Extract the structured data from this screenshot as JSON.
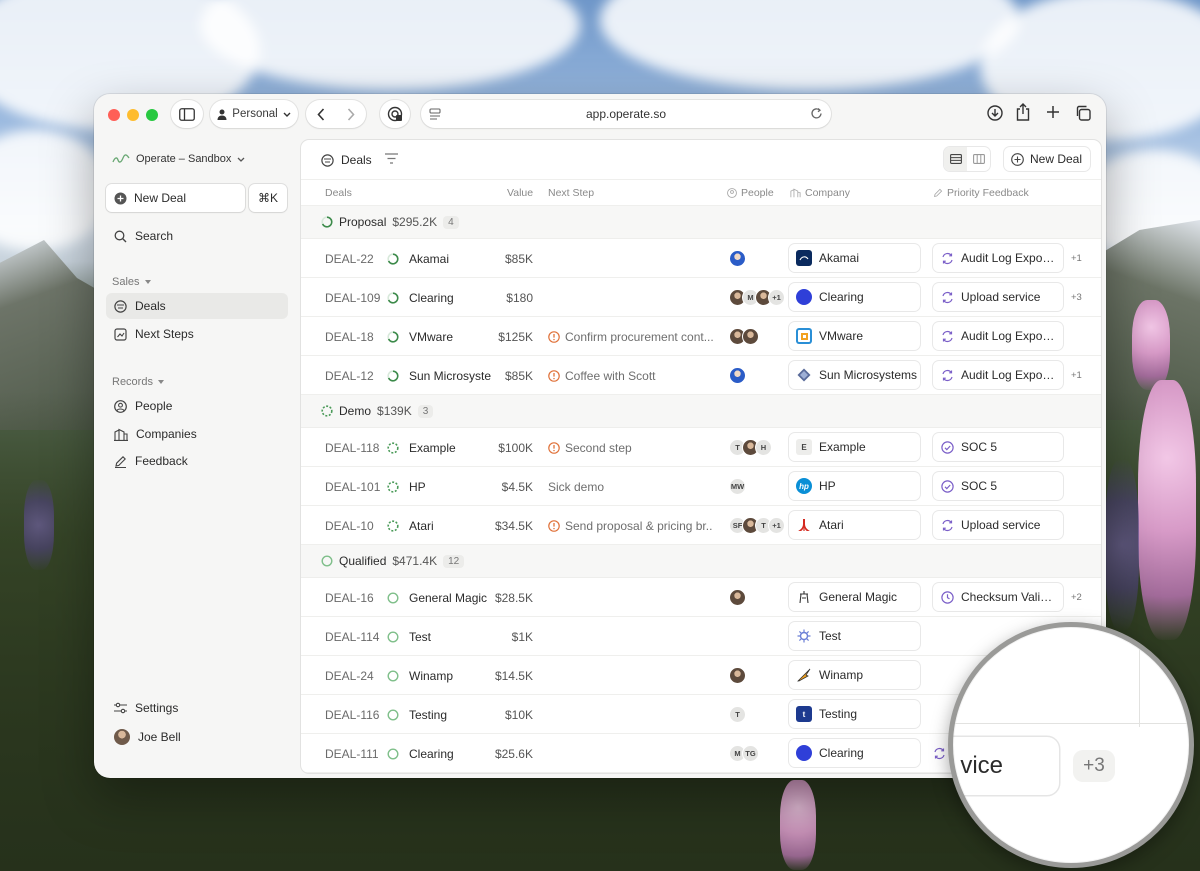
{
  "browser": {
    "profile": "Personal",
    "url": "app.operate.so"
  },
  "sidebar": {
    "workspace": "Operate – Sandbox",
    "new_deal": "New Deal",
    "shortcut": "⌘K",
    "search": "Search",
    "sales_section": "Sales",
    "deals": "Deals",
    "next_steps": "Next Steps",
    "records_section": "Records",
    "people": "People",
    "companies": "Companies",
    "feedback": "Feedback",
    "settings": "Settings",
    "user": "Joe Bell"
  },
  "main": {
    "title": "Deals",
    "new_deal": "New Deal",
    "columns": {
      "deals": "Deals",
      "value": "Value",
      "next_step": "Next Step",
      "people": "People",
      "company": "Company",
      "priority_feedback": "Priority Feedback"
    }
  },
  "groups": [
    {
      "name": "Proposal",
      "amount": "$295.2K",
      "count": "4",
      "rows": [
        {
          "id": "DEAL-22",
          "name": "Akamai",
          "value": "$85K",
          "step": "",
          "step_flag": false,
          "people": [
            "blue"
          ],
          "company": "Akamai",
          "logo": "akamai",
          "feedback": "Audit Log Export...",
          "fb_icon": "sync",
          "more": "+1"
        },
        {
          "id": "DEAL-109",
          "name": "Clearing",
          "value": "$180",
          "step": "",
          "step_flag": false,
          "people": [
            "photo",
            "M",
            "photo",
            "+1"
          ],
          "company": "Clearing",
          "logo": "clearing",
          "feedback": "Upload service",
          "fb_icon": "sync",
          "more": "+3"
        },
        {
          "id": "DEAL-18",
          "name": "VMware",
          "value": "$125K",
          "step": "Confirm procurement cont...",
          "step_flag": true,
          "people": [
            "photo",
            "photo"
          ],
          "company": "VMware",
          "logo": "vmware",
          "feedback": "Audit Log Export...",
          "fb_icon": "sync",
          "more": ""
        },
        {
          "id": "DEAL-12",
          "name": "Sun Microsystems",
          "value": "$85K",
          "step": "Coffee with Scott",
          "step_flag": true,
          "people": [
            "blue"
          ],
          "company": "Sun Microsystems",
          "logo": "sun",
          "feedback": "Audit Log Export...",
          "fb_icon": "sync",
          "more": "+1"
        }
      ]
    },
    {
      "name": "Demo",
      "amount": "$139K",
      "count": "3",
      "rows": [
        {
          "id": "DEAL-118",
          "name": "Example",
          "value": "$100K",
          "step": "Second step",
          "step_flag": true,
          "people": [
            "T",
            "photo",
            "H"
          ],
          "company": "Example",
          "logo": "example",
          "feedback": "SOC 5",
          "fb_icon": "check",
          "more": ""
        },
        {
          "id": "DEAL-101",
          "name": "HP",
          "value": "$4.5K",
          "step": "Sick demo",
          "step_flag": false,
          "people": [
            "MW"
          ],
          "company": "HP",
          "logo": "hp",
          "feedback": "SOC 5",
          "fb_icon": "check",
          "more": ""
        },
        {
          "id": "DEAL-10",
          "name": "Atari",
          "value": "$34.5K",
          "step": "Send proposal & pricing br...",
          "step_flag": true,
          "people": [
            "SF",
            "photo",
            "T",
            "+1"
          ],
          "company": "Atari",
          "logo": "atari",
          "feedback": "Upload service",
          "fb_icon": "sync",
          "more": ""
        }
      ]
    },
    {
      "name": "Qualified",
      "amount": "$471.4K",
      "count": "12",
      "rows": [
        {
          "id": "DEAL-16",
          "name": "General Magic",
          "value": "$28.5K",
          "step": "",
          "step_flag": false,
          "people": [
            "photo"
          ],
          "company": "General Magic",
          "logo": "gm",
          "feedback": "Checksum Valida...",
          "fb_icon": "clock",
          "more": "+2"
        },
        {
          "id": "DEAL-114",
          "name": "Test",
          "value": "$1K",
          "step": "",
          "step_flag": false,
          "people": [],
          "company": "Test",
          "logo": "test",
          "feedback": "",
          "fb_icon": "",
          "more": ""
        },
        {
          "id": "DEAL-24",
          "name": "Winamp",
          "value": "$14.5K",
          "step": "",
          "step_flag": false,
          "people": [
            "photo"
          ],
          "company": "Winamp",
          "logo": "winamp",
          "feedback": "",
          "fb_icon": "",
          "more": ""
        },
        {
          "id": "DEAL-116",
          "name": "Testing",
          "value": "$10K",
          "step": "",
          "step_flag": false,
          "people": [
            "T"
          ],
          "company": "Testing",
          "logo": "testing",
          "feedback": "",
          "fb_icon": "",
          "more": ""
        },
        {
          "id": "DEAL-111",
          "name": "Clearing",
          "value": "$25.6K",
          "step": "",
          "step_flag": false,
          "people": [
            "M",
            "TG"
          ],
          "company": "Clearing",
          "logo": "clearing",
          "feedback": "",
          "fb_icon": "sync",
          "more": ""
        }
      ]
    }
  ],
  "magnifier": {
    "text": "vice",
    "count": "+3"
  },
  "colors": {
    "progress_green": "#3c8a4a",
    "warn_orange": "#e0723a",
    "fb_purple": "#7b5fc8"
  }
}
